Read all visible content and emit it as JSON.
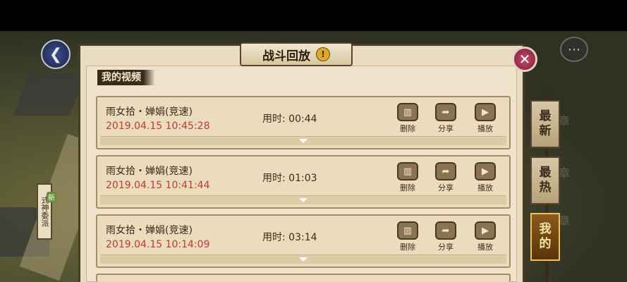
{
  "window": {
    "title": "战斗回放"
  },
  "section_label": "我的视频",
  "videos": [
    {
      "name": "雨女拾・婵娟(竞速)",
      "date": "2019.04.15 10:45:28",
      "duration_label": "用时:",
      "duration": "00:44"
    },
    {
      "name": "雨女拾・婵娟(竞速)",
      "date": "2019.04.15 10:41:44",
      "duration_label": "用时:",
      "duration": "01:03"
    },
    {
      "name": "雨女拾・婵娟(竞速)",
      "date": "2019.04.15 10:14:09",
      "duration_label": "用时:",
      "duration": "03:14"
    }
  ],
  "actions": {
    "delete": "删除",
    "share": "分享",
    "play": "播放"
  },
  "tabs": [
    {
      "line1": "最",
      "line2": "新",
      "active": false
    },
    {
      "line1": "最",
      "line2": "热",
      "active": false
    },
    {
      "line1": "我",
      "line2": "的",
      "active": true
    }
  ],
  "background": {
    "sign": "式神委派",
    "new_tag": "新",
    "chapter": "章"
  },
  "icons": {
    "back": "back-arrow-icon",
    "close": "close-icon",
    "warning": "exclamation-icon",
    "chat": "chat-icon"
  },
  "colors": {
    "date_red": "#c53a2c",
    "panel_bg": "#e9dcc0",
    "active_tab": "#8a5a1a"
  }
}
